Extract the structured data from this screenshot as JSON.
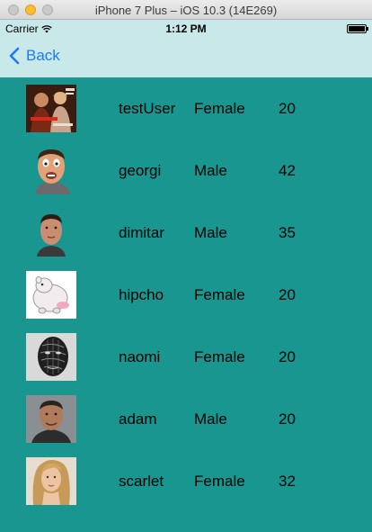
{
  "window": {
    "title": "iPhone 7 Plus – iOS 10.3 (14E269)"
  },
  "status_bar": {
    "carrier": "Carrier",
    "time": "1:12 PM"
  },
  "nav": {
    "back_label": "Back"
  },
  "colors": {
    "background": "#1a9690",
    "nav_background": "#c9e8ea",
    "back_tint": "#1a7cf0"
  },
  "users": [
    {
      "name": "testUser",
      "gender": "Female",
      "age": "20",
      "avatar": "movie-poster-photo"
    },
    {
      "name": "georgi",
      "gender": "Male",
      "age": "42",
      "avatar": "face-photo"
    },
    {
      "name": "dimitar",
      "gender": "Male",
      "age": "35",
      "avatar": "face-photo"
    },
    {
      "name": "hipcho",
      "gender": "Female",
      "age": "20",
      "avatar": "cartoon-hippo"
    },
    {
      "name": "naomi",
      "gender": "Female",
      "age": "20",
      "avatar": "face-photo"
    },
    {
      "name": "adam",
      "gender": "Male",
      "age": "20",
      "avatar": "face-photo"
    },
    {
      "name": "scarlet",
      "gender": "Female",
      "age": "32",
      "avatar": "face-photo"
    }
  ]
}
